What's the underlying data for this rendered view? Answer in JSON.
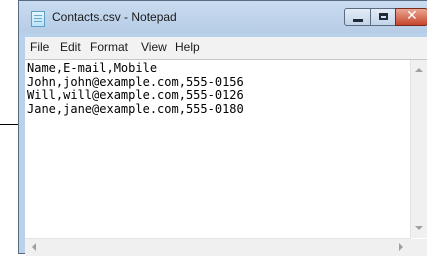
{
  "window": {
    "title": "Contacts.csv - Notepad",
    "buttons": {
      "minimize": "minimize",
      "maximize": "maximize",
      "close": "close"
    }
  },
  "menu": [
    "File",
    "Edit",
    "Format",
    "View",
    "Help"
  ],
  "document": {
    "lines": [
      "Name,E-mail,Mobile",
      "John,john@example.com,555-0156",
      "Will,will@example.com,555-0126",
      "Jane,jane@example.com,555-0180"
    ]
  },
  "icons": {
    "app": "notepad-icon",
    "scroll_up": "arrow-up-icon",
    "scroll_down": "arrow-down-icon",
    "scroll_left": "arrow-left-icon",
    "scroll_right": "arrow-right-icon"
  },
  "colors": {
    "frame": "#b9d1ea",
    "close_button": "#c7442b",
    "menubar": "#f2f2f2"
  }
}
